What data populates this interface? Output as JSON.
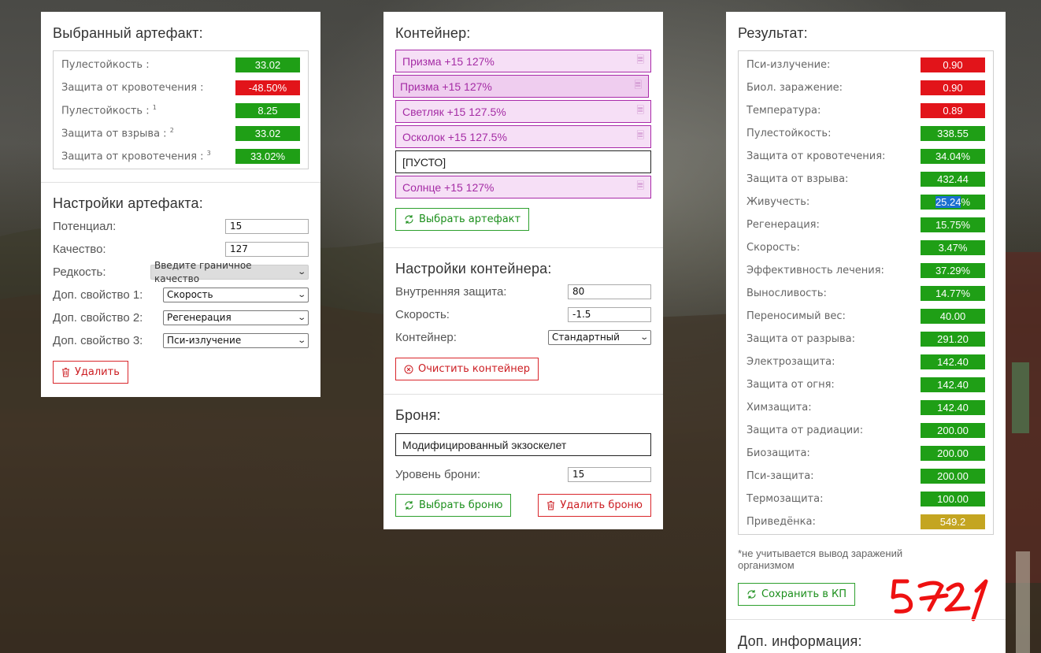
{
  "selected_artifact": {
    "title": "Выбранный артефакт:",
    "stats": [
      {
        "label": "Пулестойкость :",
        "sup": "",
        "value": "33.02",
        "color": "green"
      },
      {
        "label": "Защита от кровотечения :",
        "sup": "",
        "value": "-48.50%",
        "color": "red"
      },
      {
        "label": "Пулестойкость :",
        "sup": "1",
        "value": "8.25",
        "color": "green"
      },
      {
        "label": "Защита от взрыва :",
        "sup": "2",
        "value": "33.02",
        "color": "green"
      },
      {
        "label": "Защита от кровотечения :",
        "sup": "3",
        "value": "33.02%",
        "color": "green"
      }
    ]
  },
  "artifact_settings": {
    "title": "Настройки артефакта:",
    "potential_label": "Потенциал:",
    "potential_value": "15",
    "quality_label": "Качество:",
    "quality_value": "127",
    "rarity_label": "Редкость:",
    "rarity_value": "Введите граничное качество",
    "extra1_label": "Доп. свойство 1:",
    "extra1_value": "Скорость",
    "extra2_label": "Доп. свойство 2:",
    "extra2_value": "Регенерация",
    "extra3_label": "Доп. свойство 3:",
    "extra3_value": "Пси-излучение",
    "delete_label": "Удалить"
  },
  "container": {
    "title": "Контейнер:",
    "slots": [
      {
        "label": "Призма +15 127%",
        "filled": true
      },
      {
        "label": "Призма +15 127%",
        "filled": true
      },
      {
        "label": "Светляк +15 127.5%",
        "filled": true
      },
      {
        "label": "Осколок +15 127.5%",
        "filled": true
      },
      {
        "label": "[ПУСТО]",
        "filled": false
      },
      {
        "label": "Солнце +15 127%",
        "filled": true
      }
    ],
    "choose_artifact_label": "Выбрать артефакт"
  },
  "container_settings": {
    "title": "Настройки контейнера:",
    "inner_protection_label": "Внутренняя защита:",
    "inner_protection_value": "80",
    "speed_label": "Скорость:",
    "speed_value": "-1.5",
    "container_label": "Контейнер:",
    "container_value": "Стандартный",
    "clear_label": "Очистить контейнер"
  },
  "armor": {
    "title": "Броня:",
    "name": "Модифицированный экзоскелет",
    "level_label": "Уровень брони:",
    "level_value": "15",
    "choose_label": "Выбрать броню",
    "delete_label": "Удалить броню"
  },
  "result": {
    "title": "Результат:",
    "stats": [
      {
        "label": "Пси-излучение:",
        "value": "0.90",
        "color": "red"
      },
      {
        "label": "Биол. заражение:",
        "value": "0.90",
        "color": "red"
      },
      {
        "label": "Температура:",
        "value": "0.89",
        "color": "red"
      },
      {
        "label": "Пулестойкость:",
        "value": "338.55",
        "color": "green"
      },
      {
        "label": "Защита от кровотечения:",
        "value": "34.04%",
        "color": "green"
      },
      {
        "label": "Защита от взрыва:",
        "value": "432.44",
        "color": "green"
      },
      {
        "label": "Живучесть:",
        "value": "25.24%",
        "color": "green",
        "highlight": "25.24"
      },
      {
        "label": "Регенерация:",
        "value": "15.75%",
        "color": "green"
      },
      {
        "label": "Скорость:",
        "value": "3.47%",
        "color": "green"
      },
      {
        "label": "Эффективность лечения:",
        "value": "37.29%",
        "color": "green"
      },
      {
        "label": "Выносливость:",
        "value": "14.77%",
        "color": "green"
      },
      {
        "label": "Переносимый вес:",
        "value": "40.00",
        "color": "green"
      },
      {
        "label": "Защита от разрыва:",
        "value": "291.20",
        "color": "green"
      },
      {
        "label": "Электрозащита:",
        "value": "142.40",
        "color": "green"
      },
      {
        "label": "Защита от огня:",
        "value": "142.40",
        "color": "green"
      },
      {
        "label": "Химзащита:",
        "value": "142.40",
        "color": "green"
      },
      {
        "label": "Защита от радиации:",
        "value": "200.00",
        "color": "green"
      },
      {
        "label": "Биозащита:",
        "value": "200.00",
        "color": "green"
      },
      {
        "label": "Пси-защита:",
        "value": "200.00",
        "color": "green"
      },
      {
        "label": "Термозащита:",
        "value": "100.00",
        "color": "green"
      },
      {
        "label": "Приведёнка:",
        "value": "549.2",
        "color": "yellow"
      }
    ],
    "note": "*не учитывается вывод заражений организмом",
    "save_label": "Сохранить в КП",
    "handwritten": "5?1"
  },
  "extra_info": {
    "title": "Доп. информация:"
  },
  "colors": {
    "green": "#1f9f16",
    "red": "#e2141a",
    "yellow": "#c4a521",
    "slot_purple": "#a92aa9"
  }
}
